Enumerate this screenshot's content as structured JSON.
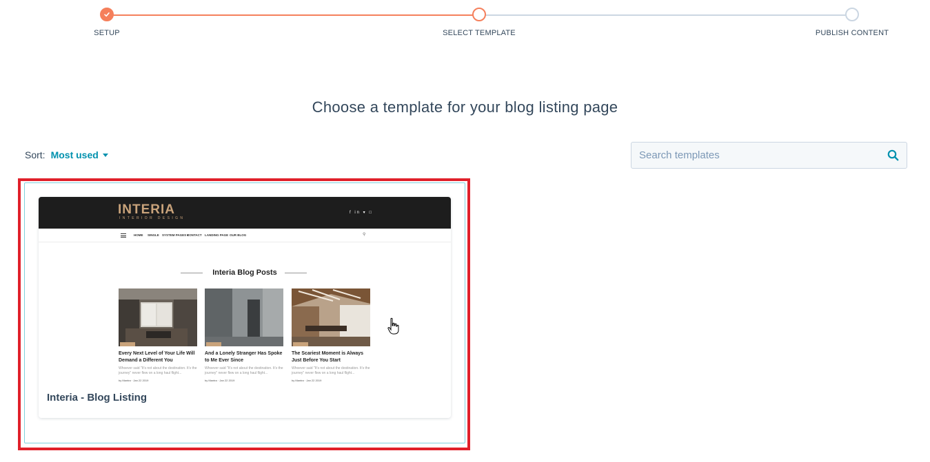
{
  "stepper": {
    "steps": [
      {
        "label": "SETUP",
        "state": "complete"
      },
      {
        "label": "SELECT TEMPLATE",
        "state": "active"
      },
      {
        "label": "PUBLISH CONTENT",
        "state": "upcoming"
      }
    ]
  },
  "heading": "Choose a template for your blog listing page",
  "sort": {
    "label": "Sort:",
    "value": "Most used"
  },
  "search": {
    "placeholder": "Search templates"
  },
  "template_card": {
    "title": "Interia - Blog Listing",
    "preview": {
      "logo": "INTERIA",
      "logo_sub": "INTERIOR DESIGN",
      "social": "f in ▾ □",
      "nav": [
        "HOME",
        "SINGLE",
        "SYSTEM PAGES ▾",
        "CONTACT",
        "LANDING PAGE",
        "OUR BLOG"
      ],
      "section_title": "Interia Blog Posts",
      "posts": [
        {
          "tag": "",
          "title": "Every Next Level of Your Life Will Demand a Different You",
          "excerpt": "Whoever said \"It's not about the destination. It's the journey\" never flew on a long haul flight...",
          "meta": "by Mantra · Jan 22 2019"
        },
        {
          "tag": "",
          "title": "And a Lonely Stranger Has Spoke to Me Ever Since",
          "excerpt": "Whoever said \"It's not about the destination. It's the journey\" never flew on a long haul flight...",
          "meta": "by Mantra · Jan 22 2019"
        },
        {
          "tag": "",
          "title": "The Scariest Moment is Always Just Before You Start",
          "excerpt": "Whoever said \"It's not about the destination. It's the journey\" never flew on a long haul flight...",
          "meta": "by Mantra · Jan 22 2019"
        }
      ]
    }
  },
  "colors": {
    "accent": "#f57f5b",
    "link": "#0091ae",
    "text": "#33475b",
    "highlight": "#e0202a",
    "selected_border": "#7fd1de"
  }
}
